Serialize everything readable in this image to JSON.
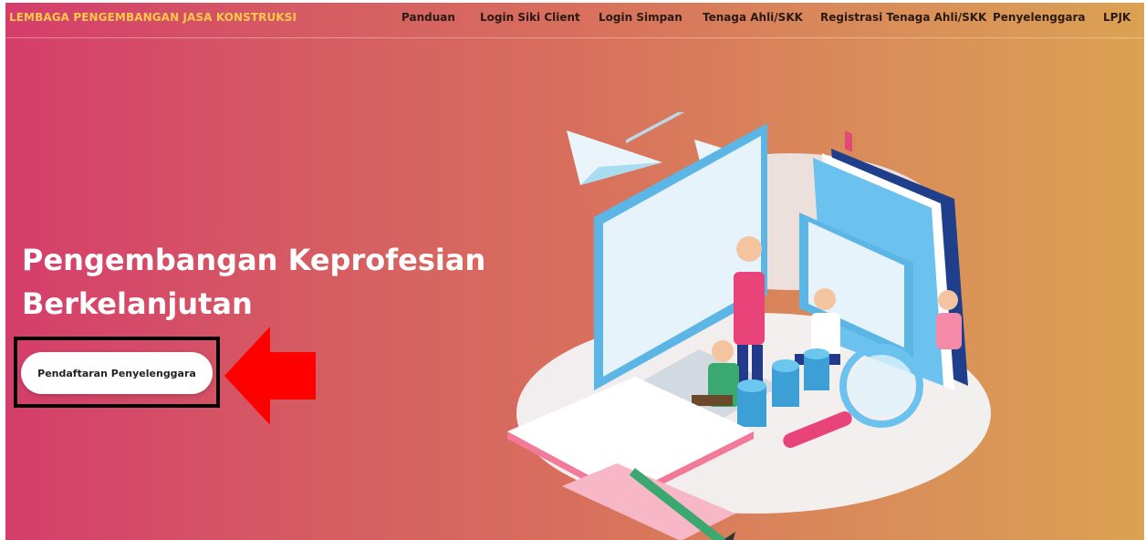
{
  "header": {
    "brand": "LEMBAGA PENGEMBANGAN JASA KONSTRUKSI",
    "nav": [
      {
        "label": "Panduan"
      },
      {
        "label": "Login Siki Client"
      },
      {
        "label": "Login Simpan"
      },
      {
        "label": "Tenaga Ahli/SKK"
      },
      {
        "label": "Registrasi Tenaga Ahli/SKK"
      },
      {
        "label": "Penyelenggara"
      },
      {
        "label": "LPJK"
      }
    ]
  },
  "hero": {
    "title_line1": "Pengembangan Keprofesian",
    "title_line2": "Berkelanjutan",
    "cta_label": "Pendaftaran Penyelenggara"
  },
  "colors": {
    "gradient_start": "#d53d6b",
    "gradient_end": "#dba253",
    "brand_text": "#ffc94a",
    "annotation_arrow": "#ff0000",
    "annotation_frame": "#000000"
  },
  "icons": {
    "annotation_arrow": "left-arrow-icon",
    "illustration": "e-learning-illustration"
  }
}
